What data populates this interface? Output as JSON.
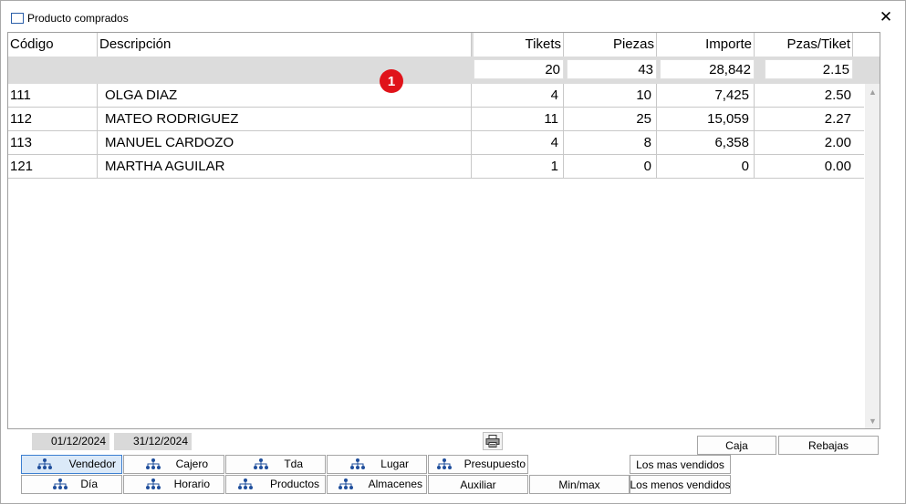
{
  "window": {
    "title": "Producto comprados",
    "close_glyph": "✕"
  },
  "grid": {
    "columns": [
      "Código",
      "Descripción",
      "Tikets",
      "Piezas",
      "Importe",
      "Pzas/Tiket"
    ],
    "totals": {
      "tikets": "20",
      "piezas": "43",
      "importe": "28,842",
      "pzas_tiket": "2.15"
    },
    "marker": "1",
    "rows": [
      {
        "codigo": "111",
        "descripcion": "OLGA DIAZ",
        "tikets": "4",
        "piezas": "10",
        "importe": "7,425",
        "pzas_tiket": "2.50"
      },
      {
        "codigo": "112",
        "descripcion": "MATEO RODRIGUEZ",
        "tikets": "11",
        "piezas": "25",
        "importe": "15,059",
        "pzas_tiket": "2.27"
      },
      {
        "codigo": "113",
        "descripcion": "MANUEL CARDOZO",
        "tikets": "4",
        "piezas": "8",
        "importe": "6,358",
        "pzas_tiket": "2.00"
      },
      {
        "codigo": "121",
        "descripcion": "MARTHA AGUILAR",
        "tikets": "1",
        "piezas": "0",
        "importe": "0",
        "pzas_tiket": "0.00"
      }
    ]
  },
  "filters": {
    "date_from": "01/12/2024",
    "date_to": "31/12/2024"
  },
  "buttons": {
    "row1": [
      "Vendedor",
      "Cajero",
      "Tda",
      "Lugar",
      "Presupuesto"
    ],
    "row2": [
      "Día",
      "Horario",
      "Productos",
      "Almacenes",
      "Auxiliar",
      "Min/max"
    ],
    "caja": "Caja",
    "rebajas": "Rebajas",
    "los_mas_vendidos": "Los mas vendidos",
    "los_menos_vendidos": "Los menos vendidos"
  },
  "icons": {
    "title": "window-icon",
    "group": "group-tree-icon",
    "print": "printer-icon"
  },
  "colors": {
    "marker_bg": "#e0131a",
    "active_button_bg": "#dbe9f8",
    "summary_bg": "#dcdcdc"
  }
}
